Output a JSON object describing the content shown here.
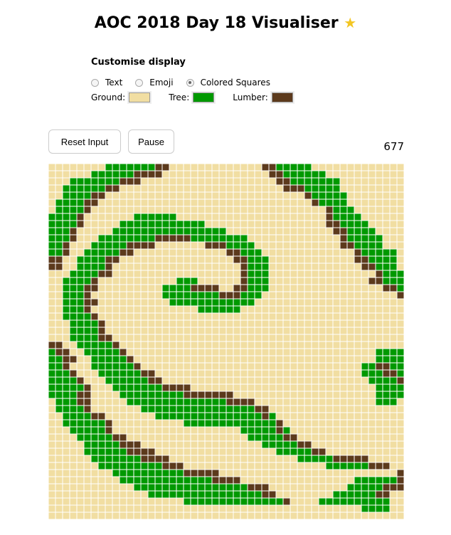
{
  "title": "AOC 2018 Day 18 Visualiser",
  "title_icon": "star-icon",
  "customise": {
    "heading": "Customise display",
    "options": [
      {
        "label": "Text",
        "checked": false
      },
      {
        "label": "Emoji",
        "checked": false
      },
      {
        "label": "Colored Squares",
        "checked": true
      }
    ],
    "colors": {
      "ground": {
        "label": "Ground:",
        "value": "#f1dea2"
      },
      "tree": {
        "label": "Tree:",
        "value": "#009900"
      },
      "lumber": {
        "label": "Lumber:",
        "value": "#5c3a1c"
      }
    }
  },
  "controls": {
    "reset_label": "Reset Input",
    "pause_label": "Pause"
  },
  "generation": "677",
  "grid": {
    "cols": 50,
    "rows_visible": 50,
    "legend": {
      ".": "ground",
      "|": "tree",
      "#": "lumber"
    },
    "rows": [
      "........|||||||##.............##|||||.............",
      "......||||||####...............##||||||...........",
      "...|||||||###...................##|||||||.........",
      "..||||||##.......................###|||||.........",
      "..||||##............................#|||||........",
      ".||||##..............................#||||........",
      ".||||#.................................#|||.......",
      "||||#.......||||||.....................#||||......",
      "||||#.....||||||||||||.................##||||.....",
      "|||#.....||||||||||||||||...............##||||....",
      "|||#...||||||||#####||||||||.............#|||||...",
      "||#...|||||####.......###||||............##||||...",
      "||#..|||||##.............##|||.............#|||||.",
      "##..||||##................##|||............##||||.",
      "##..||||#..................#|||.............##|||.",
      "...||||##..................#|||...............#|||",
      "..||||#...........|||......#|||..............##|||",
      "..|||##.........||||####..##|||................##|",
      "..|||#..........||||||||###|||...................#",
      "..|||##..........||||||||||||.....................",
      "..|||#...............||||||.......................",
      "..||||#...........................................",
      "...||||#..........................................",
      "...||||#..........................................",
      "...||||##.........................................",
      "##..|||||#........................................",
      "|##..|||||#...................................||||.",
      "||##..|||||#..................................|||||",
      "||#...||||||#...............................||##||",
      "|||#...||||||##.............................|||##|",
      "||||#...||||||##.............................||||#",
      "|||||#...|||||||####..........................||||",
      "||||##....|||||||||#######....................||||",
      ".|||##.....||||||||||||||####.................|||.",
      ".||||#.......||||||||||||||||##..................",
      "..||||##.......|||||||||||||||#|.................",
      "..||||||#..........|||||||||||||#................",
      "...|||||#..................|||||#|...............",
      "....|||||##.................|||||##..............",
      ".....|||||###.................|||||##............",
      ".....||||||####.................|||||##..........",
      "......|||||||####..................|||||#####.....",
      ".......|||||||||###....................||||||###..",
      ".........||||||||||#####.........................#",
      "..........|||||||||||||####................||||||#",
      "............||||||||||||||||###...........|||||###",
      "..............||||||||||||||||##........||||||##..",
      "...................||||||||||||||#....||||||||||..",
      "............................................||||.",
      ".................................................."
    ]
  }
}
